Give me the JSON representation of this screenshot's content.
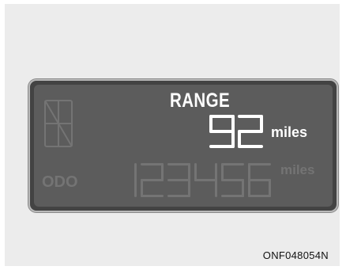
{
  "display": {
    "range_label": "RANGE",
    "range_value": "92",
    "range_unit": "miles",
    "odo_label": "ODO",
    "odo_value": "123456",
    "odo_unit": "miles"
  },
  "image_code": "ONF048054N",
  "colors": {
    "lcd_background": "#5c5c5c",
    "active_segment": "#ffffff",
    "inactive_segment": "#747474"
  }
}
